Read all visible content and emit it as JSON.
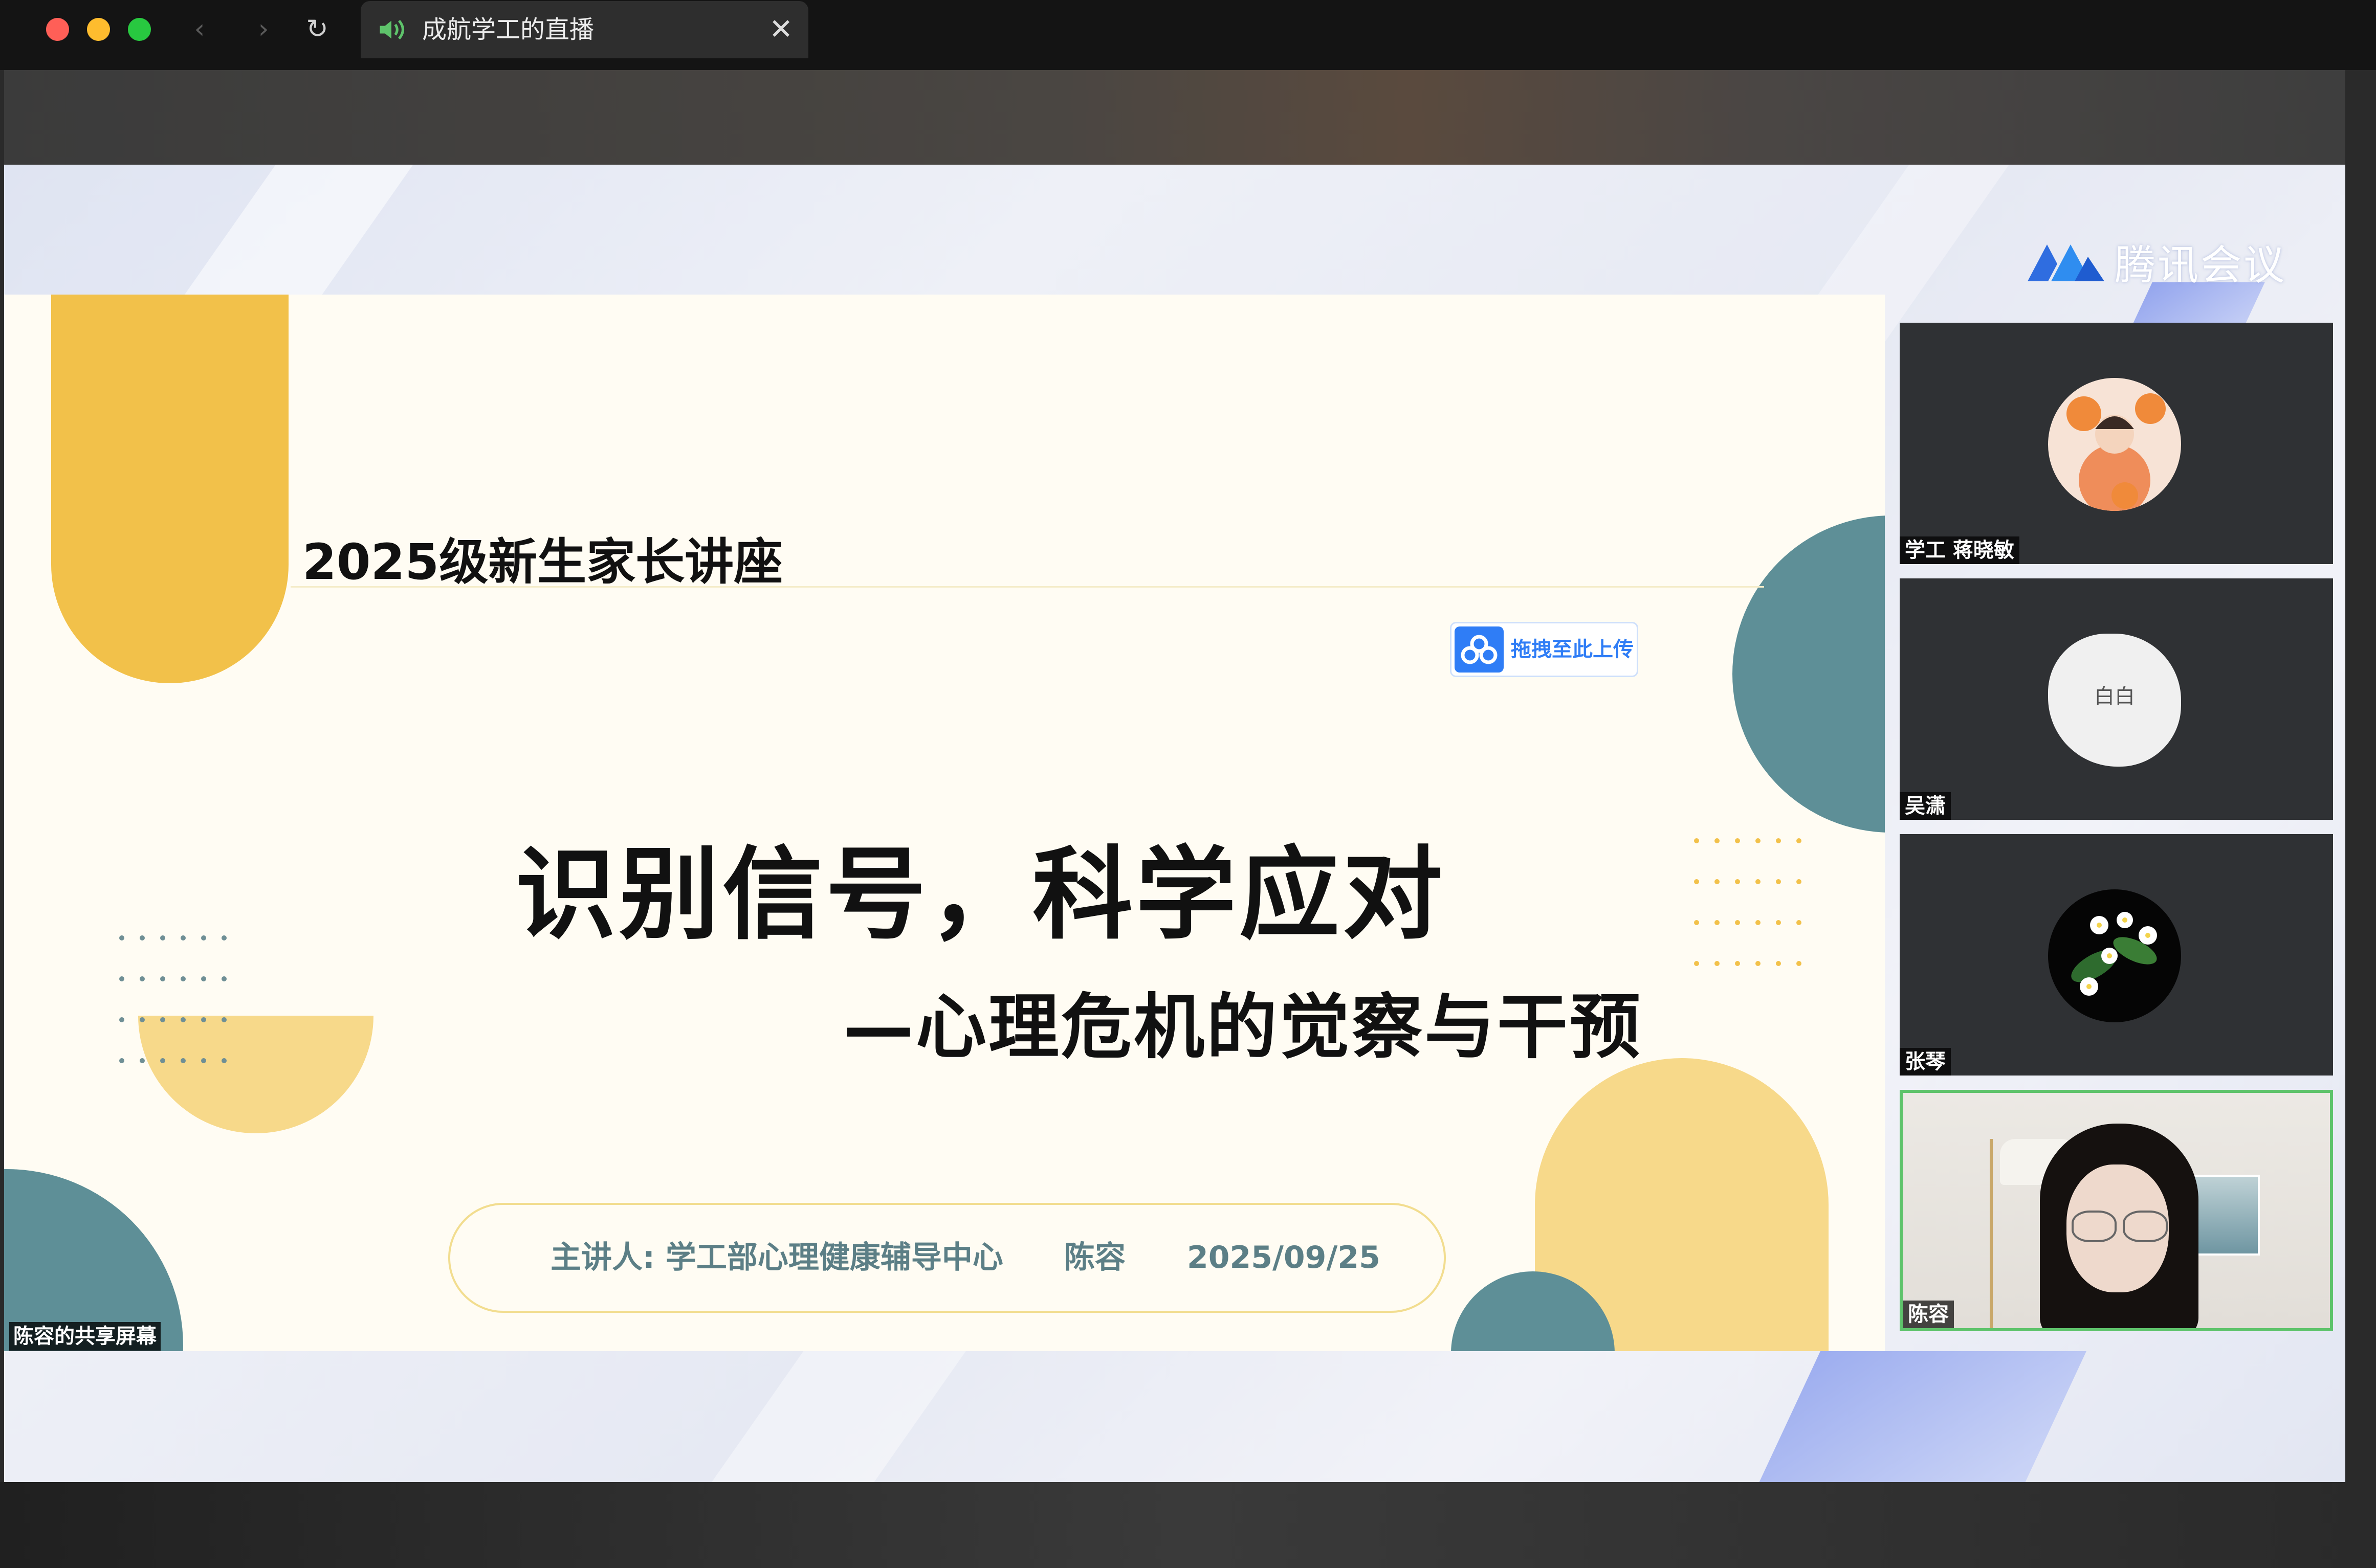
{
  "browser": {
    "tab_title": "成航学工的直播",
    "tab_close": "✕",
    "back_glyph": "‹",
    "forward_glyph": "›",
    "reload_glyph": "↻",
    "traffic_colors": [
      "#ff5f57",
      "#febc2e",
      "#28c840"
    ]
  },
  "meeting": {
    "brand_name": "腾讯会议",
    "share_label": "陈容的共享屏幕"
  },
  "slide": {
    "header": "2025级新生家长讲座",
    "upload_label": "拖拽至此上传",
    "title": "识别信号，科学应对",
    "subtitle": "—心理危机的觉察与干预",
    "speaker": "主讲人: 学工部心理健康辅导中心",
    "speaker_name": "陈容",
    "date": "2025/09/25",
    "colors": {
      "yellow": "#f2c14a",
      "light_yellow": "#f7d98a",
      "teal": "#5e8f97",
      "text_teal": "#5c7f86"
    }
  },
  "participants": [
    {
      "name": "学工 蒋晓敏",
      "avatar": "cartoon-girl-avatar"
    },
    {
      "name": "吴潇",
      "avatar": "white-text-avatar",
      "avatar_text": "白白"
    },
    {
      "name": "张琴",
      "avatar": "jasmine-flower-avatar"
    },
    {
      "name": "陈容",
      "avatar": "camera-video",
      "active": true
    }
  ]
}
